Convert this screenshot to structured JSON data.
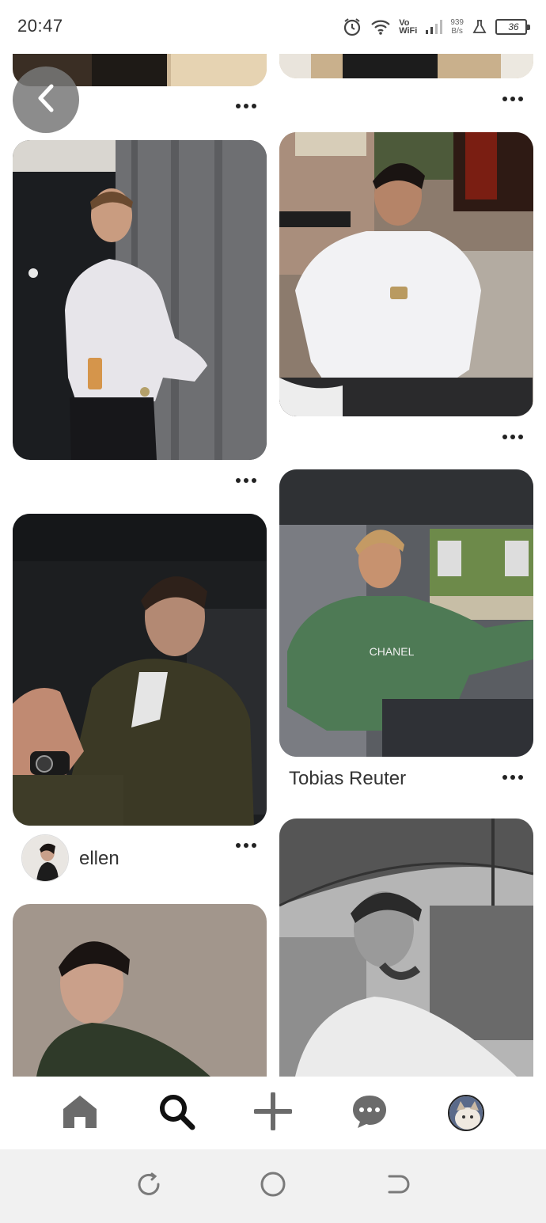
{
  "status_bar": {
    "time": "20:47",
    "volte_top": "Vo",
    "volte_bottom": "WiFi",
    "net_speed_value": "939",
    "net_speed_unit": "B/s",
    "battery_level": "36"
  },
  "feed": {
    "pins": [
      {
        "id": "pin-1",
        "title": ""
      },
      {
        "id": "pin-2",
        "title": ""
      },
      {
        "id": "pin-3",
        "title": ""
      },
      {
        "id": "pin-4",
        "title": ""
      },
      {
        "id": "pin-5",
        "title": ""
      },
      {
        "id": "pin-6",
        "title": "Tobias Reuter"
      },
      {
        "id": "pin-7",
        "title": ""
      },
      {
        "id": "pin-8",
        "title": ""
      }
    ],
    "ellen_name": "ellen",
    "shirt_logo_text": "CHANEL"
  },
  "bottom_nav": {
    "items": [
      "home-icon",
      "search-icon",
      "plus-icon",
      "chat-icon",
      "profile-avatar"
    ],
    "active": "search-icon"
  },
  "system_nav": {
    "items": [
      "recent-apps-icon",
      "home-circle-icon",
      "back-arrow-icon"
    ]
  },
  "colors": {
    "background": "#ffffff",
    "nav_icon": "#6b6b6b",
    "active_icon": "#111111",
    "system_bar": "#f1f1f1"
  }
}
